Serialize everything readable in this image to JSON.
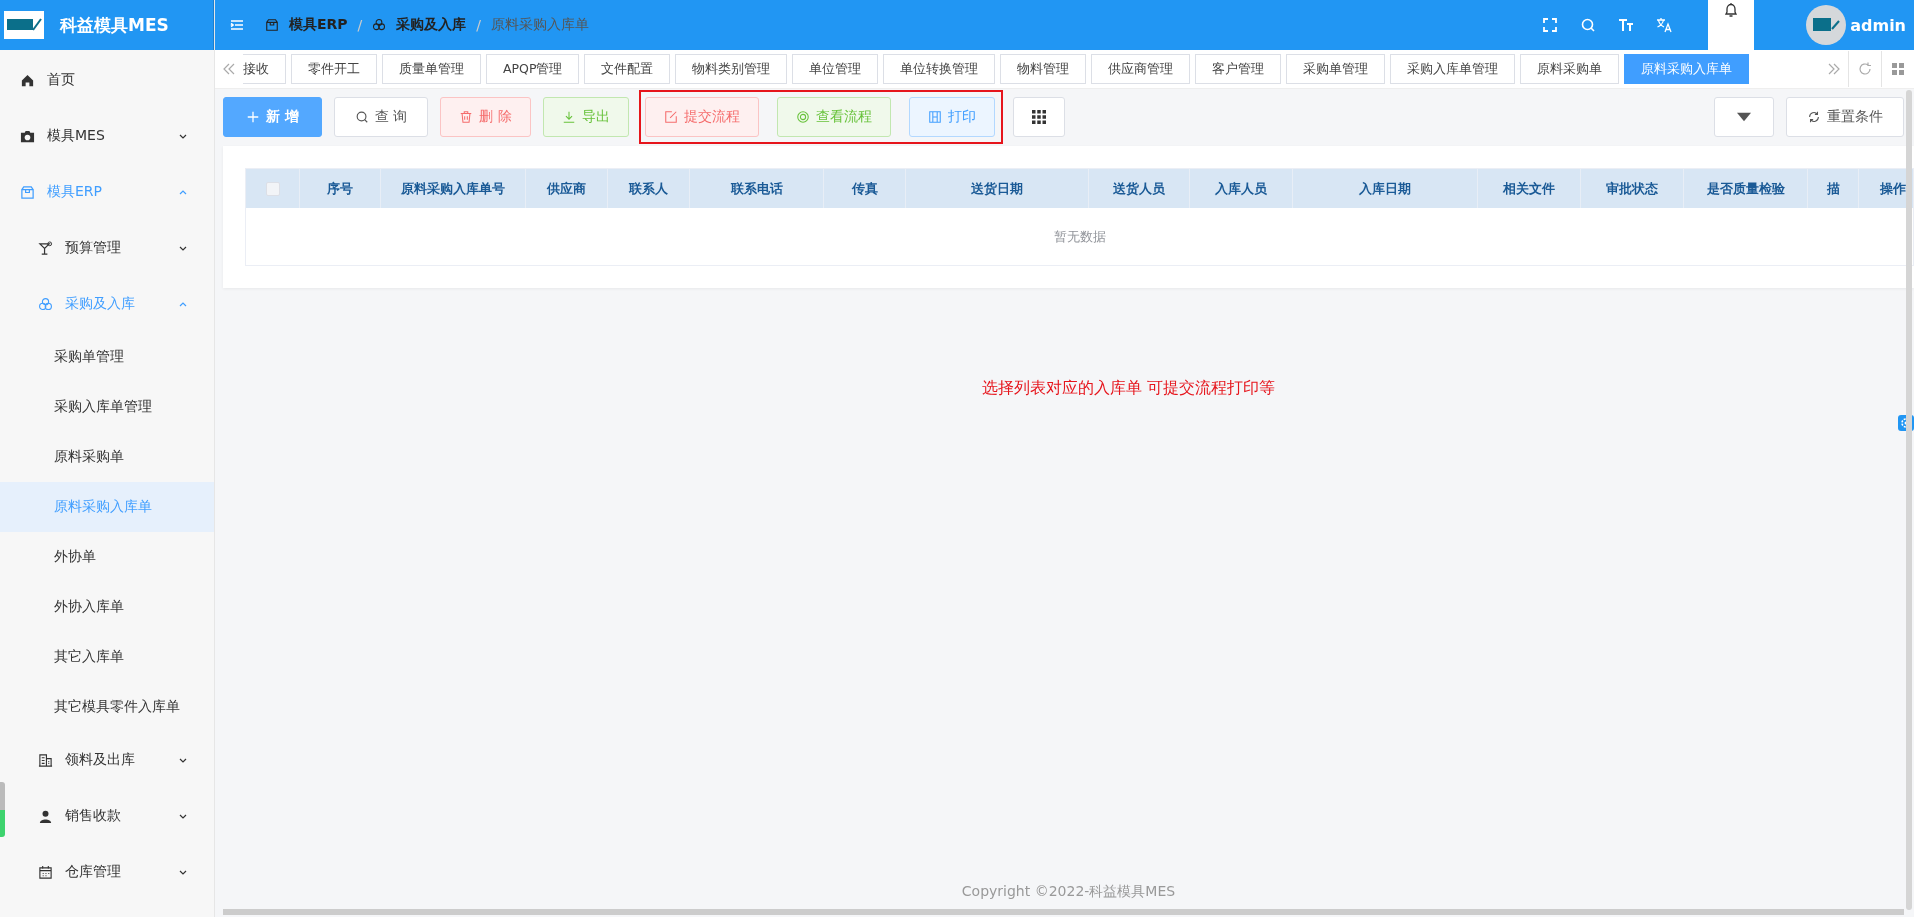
{
  "app": {
    "title": "科益模具MES",
    "user": "admin"
  },
  "sidebar": {
    "items": [
      {
        "label": "首页",
        "selected": false
      },
      {
        "label": "模具MES",
        "expanded": false,
        "selected": false
      },
      {
        "label": "模具ERP",
        "expanded": true,
        "selected": false,
        "children": [
          {
            "label": "预算管理",
            "expanded": false,
            "selected": false
          },
          {
            "label": "采购及入库",
            "expanded": true,
            "selected": false,
            "children": [
              {
                "label": "采购单管理",
                "selected": false
              },
              {
                "label": "采购入库单管理",
                "selected": false
              },
              {
                "label": "原料采购单",
                "selected": false
              },
              {
                "label": "原料采购入库单",
                "selected": true
              },
              {
                "label": "外协单",
                "selected": false
              },
              {
                "label": "外协入库单",
                "selected": false
              },
              {
                "label": "其它入库单",
                "selected": false
              },
              {
                "label": "其它模具零件入库单",
                "selected": false
              }
            ]
          },
          {
            "label": "领料及出库",
            "expanded": false,
            "selected": false
          },
          {
            "label": "销售收款",
            "expanded": false,
            "selected": false
          },
          {
            "label": "仓库管理",
            "expanded": false,
            "selected": false
          }
        ]
      }
    ]
  },
  "breadcrumb": {
    "separator": "/",
    "items": [
      {
        "label": "模具ERP"
      },
      {
        "label": "采购及入库"
      },
      {
        "label": "原料采购入库单"
      }
    ]
  },
  "tabs": [
    {
      "label": "接收",
      "selected": false
    },
    {
      "label": "零件开工",
      "selected": false
    },
    {
      "label": "质量单管理",
      "selected": false
    },
    {
      "label": "APQP管理",
      "selected": false
    },
    {
      "label": "文件配置",
      "selected": false
    },
    {
      "label": "物料类别管理",
      "selected": false
    },
    {
      "label": "单位管理",
      "selected": false
    },
    {
      "label": "单位转换管理",
      "selected": false
    },
    {
      "label": "物料管理",
      "selected": false
    },
    {
      "label": "供应商管理",
      "selected": false
    },
    {
      "label": "客户管理",
      "selected": false
    },
    {
      "label": "采购单管理",
      "selected": false
    },
    {
      "label": "采购入库单管理",
      "selected": false
    },
    {
      "label": "原料采购单",
      "selected": false
    },
    {
      "label": "原料采购入库单",
      "selected": true
    }
  ],
  "toolbar": {
    "buttons": [
      {
        "label": "新 增",
        "kind": "primary"
      },
      {
        "label": "查 询",
        "kind": "plain"
      },
      {
        "label": "删 除",
        "kind": "danger"
      },
      {
        "label": "导出",
        "kind": "success"
      }
    ],
    "highlighted": [
      {
        "label": "提交流程",
        "kind": "danger"
      },
      {
        "label": "查看流程",
        "kind": "success"
      },
      {
        "label": "打印",
        "kind": "info"
      }
    ],
    "reset": "重置条件"
  },
  "table": {
    "all_checked": false,
    "columns": [
      "序号",
      "原料采购入库单号",
      "供应商",
      "联系人",
      "联系电话",
      "传真",
      "送货日期",
      "送货人员",
      "入库人员",
      "入库日期",
      "相关文件",
      "审批状态",
      "是否质量检验",
      "描",
      "操作"
    ],
    "empty_text": "暂无数据"
  },
  "annotation": "选择列表对应的入库单 可提交流程打印等",
  "footer": "Copyright ©2022-科益模具MES"
}
